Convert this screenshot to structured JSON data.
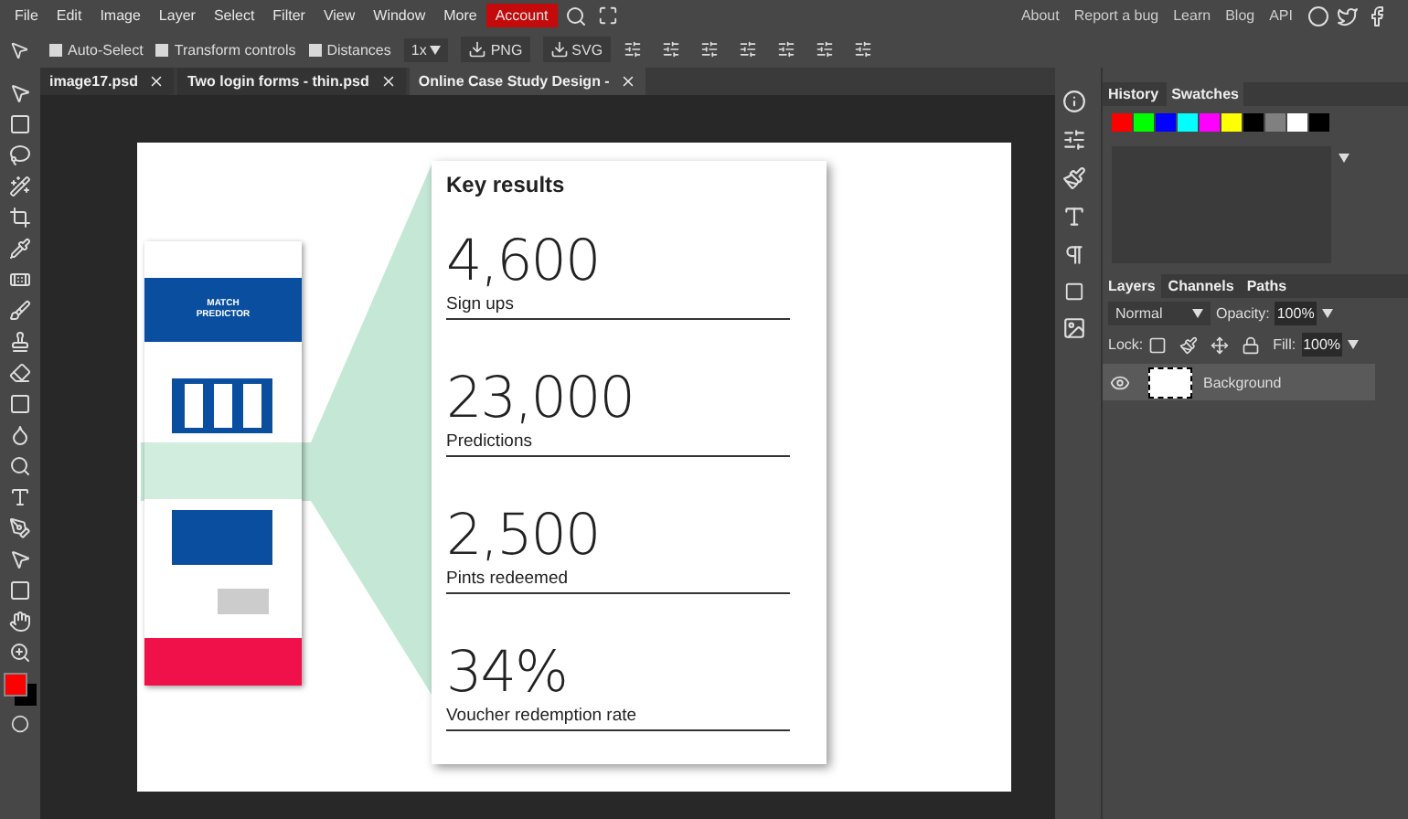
{
  "menu": [
    {
      "label": "File",
      "highlighted": false
    },
    {
      "label": "Edit",
      "highlighted": false
    },
    {
      "label": "Image",
      "highlighted": false
    },
    {
      "label": "Layer",
      "highlighted": false
    },
    {
      "label": "Select",
      "highlighted": false
    },
    {
      "label": "Filter",
      "highlighted": false
    },
    {
      "label": "View",
      "highlighted": false
    },
    {
      "label": "Window",
      "highlighted": false
    },
    {
      "label": "More",
      "highlighted": false
    },
    {
      "label": "Account",
      "highlighted": true
    }
  ],
  "links": [
    "About",
    "Report a bug",
    "Learn",
    "Blog",
    "API"
  ],
  "options": {
    "checkboxes": [
      {
        "label": "Auto-Select",
        "checked": false
      },
      {
        "label": "Transform controls",
        "checked": false
      },
      {
        "label": "Distances",
        "checked": false
      }
    ],
    "zoom": "1x",
    "exports": [
      "PNG",
      "SVG"
    ]
  },
  "tabs": [
    {
      "label": "image17.psd",
      "selected": false
    },
    {
      "label": "Two login forms - thin.psd",
      "selected": false
    },
    {
      "label": "Online Case Study Design -",
      "selected": true
    }
  ],
  "color_swatches": [
    {
      "kind": "foreground",
      "color": "#ff0000"
    },
    {
      "kind": "background",
      "color": "#000000"
    }
  ],
  "document": {
    "thumbnail_title": "MATCH PREDICTOR",
    "title": "Key results",
    "stats": [
      {
        "value": "4,600",
        "label": "Sign ups"
      },
      {
        "value": "23,000",
        "label": "Predictions"
      },
      {
        "value": "2,500",
        "label": "Pints redeemed"
      },
      {
        "value": "34%",
        "label": "Voucher redemption rate"
      }
    ]
  },
  "history_panel": {
    "tabs": [
      {
        "label": "History",
        "selected": false
      },
      {
        "label": "Swatches",
        "selected": true
      }
    ],
    "swatches": [
      {
        "color": "#ff0000"
      },
      {
        "color": "#00ff00"
      },
      {
        "color": "#0000ff"
      },
      {
        "color": "#00ffff"
      },
      {
        "color": "#ff00ff"
      },
      {
        "color": "#ffff00"
      },
      {
        "color": "#000000"
      },
      {
        "color": "#808080"
      },
      {
        "color": "#ffffff"
      },
      {
        "color": "#000000"
      }
    ]
  },
  "layers_panel": {
    "tabs": [
      {
        "label": "Layers",
        "selected": true
      },
      {
        "label": "Channels",
        "selected": false
      },
      {
        "label": "Paths",
        "selected": false
      }
    ],
    "blend_mode": "Normal",
    "opacity_label": "Opacity:",
    "opacity": "100%",
    "lock_label": "Lock:",
    "fill_label": "Fill:",
    "fill": "100%",
    "layers": [
      {
        "name": "Background",
        "visible": true,
        "selected": true
      }
    ]
  }
}
